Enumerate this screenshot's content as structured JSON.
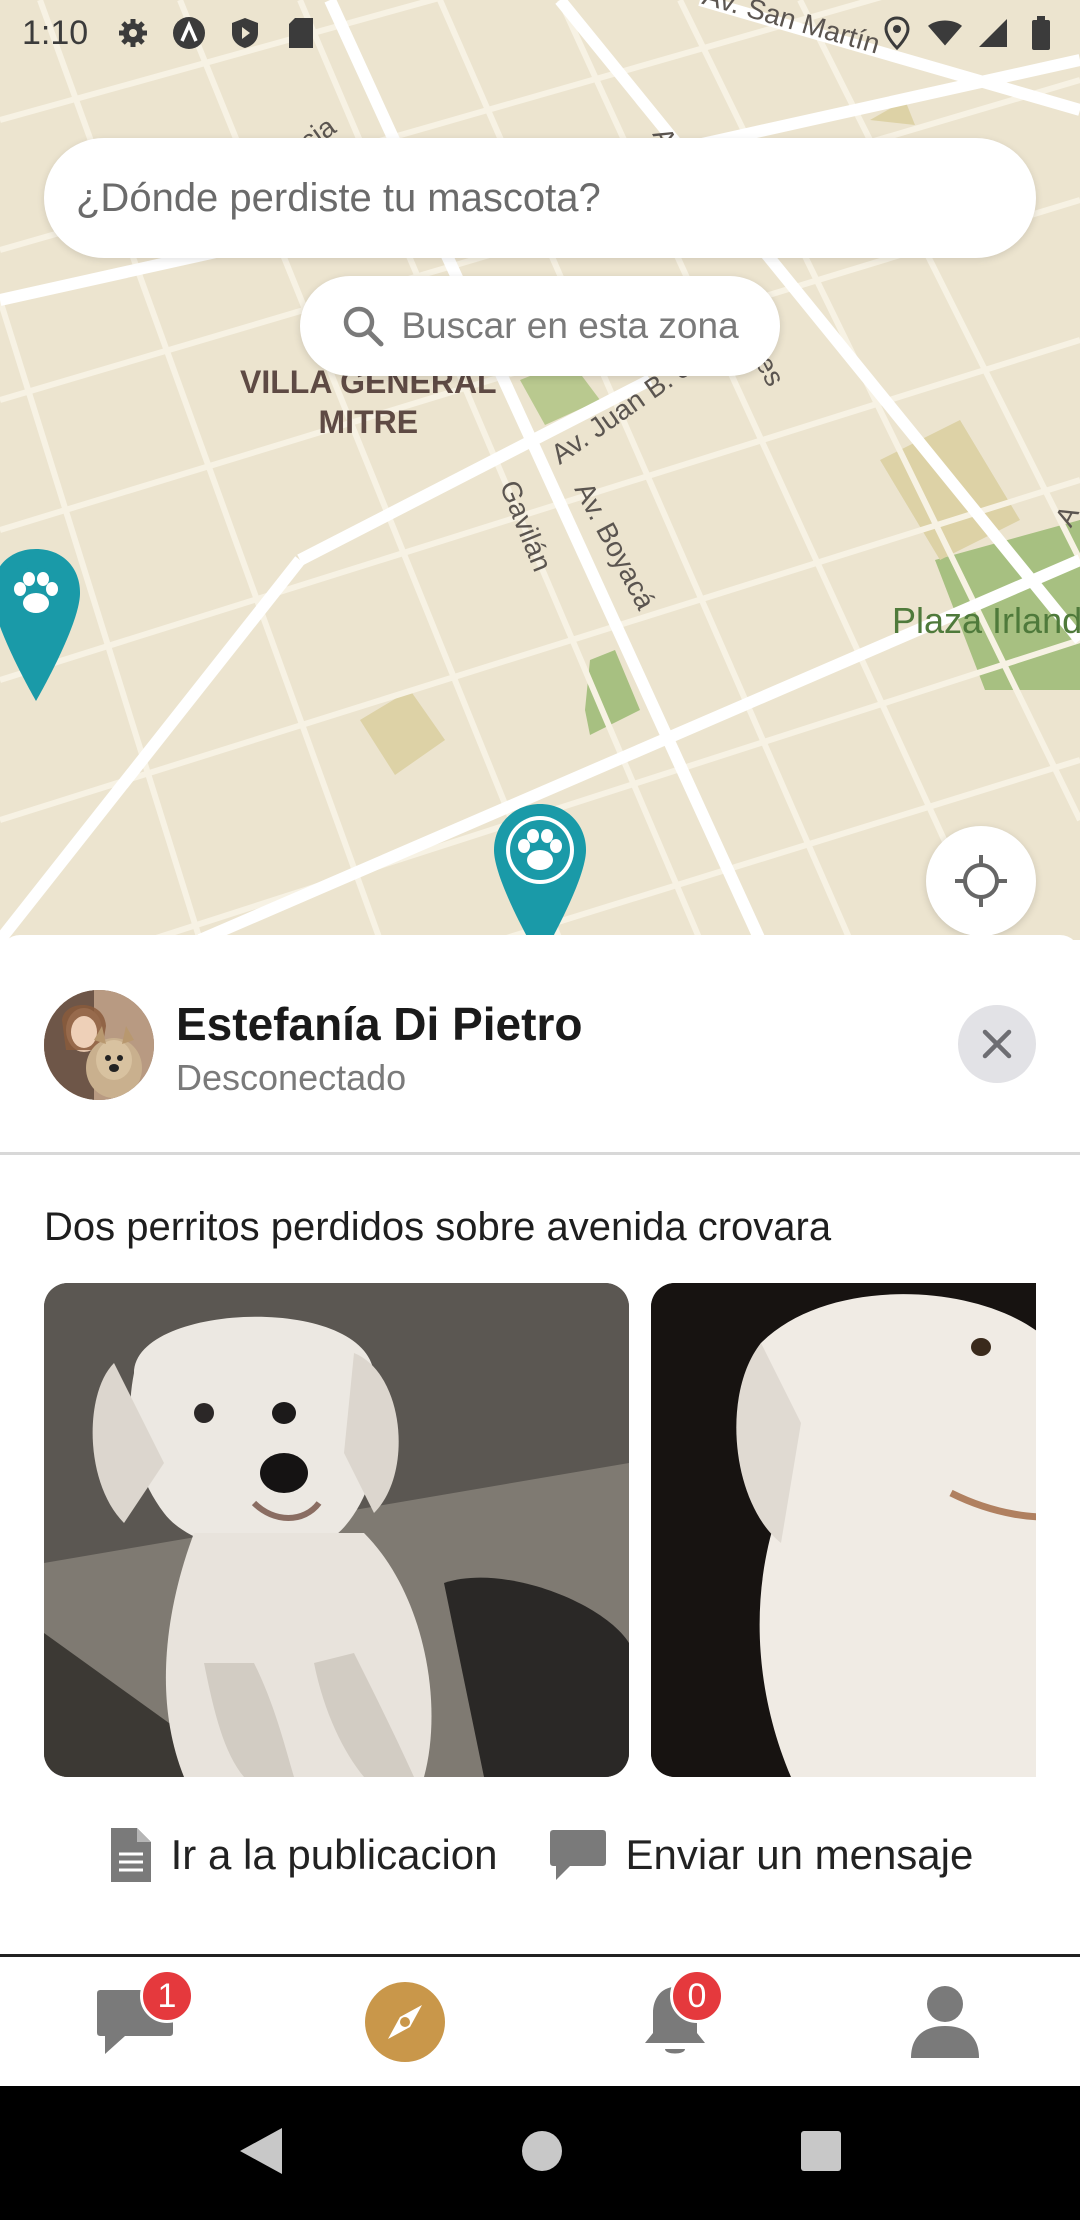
{
  "status_bar": {
    "time": "1:10",
    "icons": [
      "gear-icon",
      "a-icon",
      "shield-icon",
      "sd-card-icon",
      "location-icon",
      "wifi-icon",
      "signal-icon",
      "battery-icon"
    ]
  },
  "map": {
    "search_placeholder": "¿Dónde perdiste tu mascota?",
    "search_zone_label": "Buscar en esta zona",
    "neighborhood": "VILLA GENERAL\nMITRE",
    "streets": [
      "Av. San Martín",
      "Av. Juan B. Justo",
      "Av. Boyacá",
      "Gavilán",
      "cia",
      "A",
      "es",
      "A"
    ],
    "park": "Plaza Irland",
    "pin_color": "#1a9aa8"
  },
  "sheet": {
    "user_name": "Estefanía Di Pietro",
    "user_status": "Desconectado",
    "post_title": "Dos perritos perdidos sobre avenida crovara",
    "actions": {
      "open_post": "Ir a la publicacion",
      "send_message": "Enviar un mensaje"
    }
  },
  "bottom_nav": {
    "chat_badge": "1",
    "notifications_badge": "0",
    "accent": "#c9974a"
  }
}
